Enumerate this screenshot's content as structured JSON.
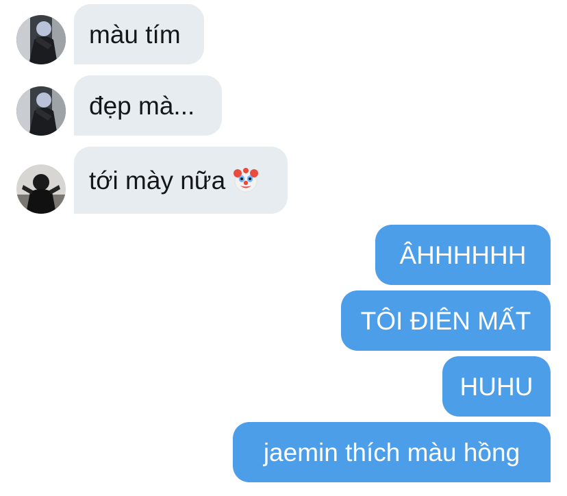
{
  "conversation": {
    "incoming": [
      {
        "text": "màu tím",
        "avatar": "avatar-user-a"
      },
      {
        "text": "đẹp mà...",
        "avatar": "avatar-user-a"
      },
      {
        "text": "tới mày nữa",
        "avatar": "avatar-user-b",
        "emoji": "clown-face-icon"
      }
    ],
    "outgoing": [
      {
        "text": "ÂHHHHHH"
      },
      {
        "text": "TÔI ĐIÊN MẤT"
      },
      {
        "text": "HUHU"
      },
      {
        "text": "jaemin thích màu hồng"
      }
    ]
  },
  "colors": {
    "incoming_bubble": "#e6ecf0",
    "outgoing_bubble": "#4c9ee8",
    "incoming_text": "#14171a",
    "outgoing_text": "#ffffff"
  }
}
